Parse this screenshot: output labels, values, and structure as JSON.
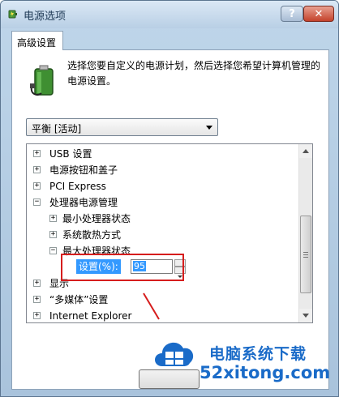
{
  "window": {
    "title": "电源选项",
    "help_label": "?",
    "close_label": "✕"
  },
  "tab": {
    "label": "高级设置"
  },
  "description": "选择您要自定义的电源计划，然后选择您希望计算机管理的电源设置。",
  "plan_select": {
    "value": "平衡 [活动]"
  },
  "tree": {
    "items": [
      {
        "label": "USB 设置",
        "expander": "+"
      },
      {
        "label": "电源按钮和盖子",
        "expander": "+"
      },
      {
        "label": "PCI Express",
        "expander": "+"
      },
      {
        "label": "处理器电源管理",
        "expander": "−"
      },
      {
        "label": "最小处理器状态",
        "expander": "+"
      },
      {
        "label": "系统散热方式",
        "expander": "+"
      },
      {
        "label": "最大处理器状态",
        "expander": "−"
      },
      {
        "label": "显示",
        "expander": "+"
      },
      {
        "label": "“多媒体”设置",
        "expander": "+"
      },
      {
        "label": "Internet Explorer",
        "expander": "+"
      }
    ],
    "setting": {
      "label": "设置(%):",
      "value": "95"
    }
  },
  "watermark": {
    "name": "电脑系统下载",
    "url": "52xitong.com"
  },
  "colors": {
    "highlight": "#3399ff",
    "annotation_red": "#d61d1d",
    "watermark_blue": "#1a6bc8"
  }
}
